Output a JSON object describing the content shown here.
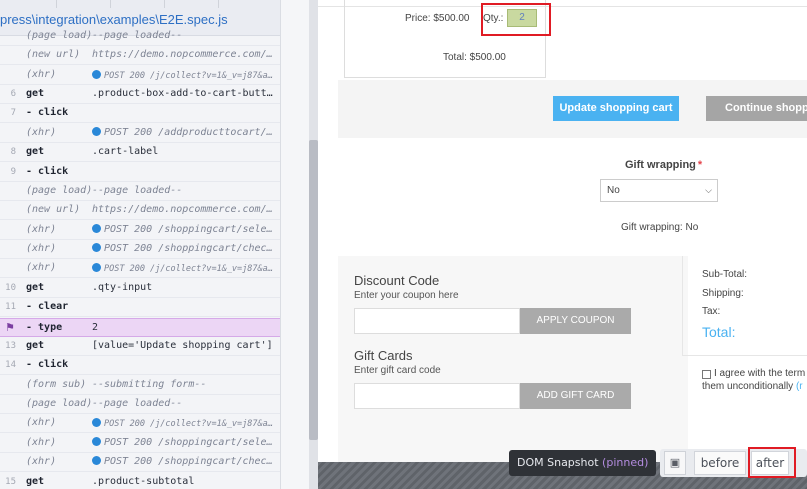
{
  "spec": {
    "path": "press\\integration\\examples\\E2E.spec.js"
  },
  "commands": [
    {
      "num": "",
      "name": "(page load)",
      "message": "--page loaded--",
      "style": "event",
      "xhr": false,
      "small": false,
      "pinned": false
    },
    {
      "num": "",
      "name": "(new url)",
      "message": "https://demo.nopcommerce.com/se…",
      "style": "event",
      "xhr": false,
      "small": false,
      "pinned": false
    },
    {
      "num": "",
      "name": "(xhr)",
      "message": "POST 200 /j/collect?v=1&_v=j87&a=1…",
      "style": "event",
      "xhr": true,
      "small": true,
      "pinned": false
    },
    {
      "num": "6",
      "name": "get",
      "message": ".product-box-add-to-cart-button",
      "style": "cmd",
      "xhr": false,
      "small": false,
      "pinned": false
    },
    {
      "num": "7",
      "name": "- click",
      "message": "",
      "style": "cmd",
      "xhr": false,
      "small": false,
      "pinned": false
    },
    {
      "num": "",
      "name": "(xhr)",
      "message": "POST 200 /addproducttocart/ca…",
      "style": "event",
      "xhr": true,
      "small": false,
      "pinned": false
    },
    {
      "num": "8",
      "name": "get",
      "message": ".cart-label",
      "style": "cmd",
      "xhr": false,
      "small": false,
      "pinned": false
    },
    {
      "num": "9",
      "name": "- click",
      "message": "",
      "style": "cmd",
      "xhr": false,
      "small": false,
      "pinned": false
    },
    {
      "num": "",
      "name": "(page load)",
      "message": "--page loaded--",
      "style": "event",
      "xhr": false,
      "small": false,
      "pinned": false
    },
    {
      "num": "",
      "name": "(new url)",
      "message": "https://demo.nopcommerce.com/ca…",
      "style": "event",
      "xhr": false,
      "small": false,
      "pinned": false
    },
    {
      "num": "",
      "name": "(xhr)",
      "message": "POST 200 /shoppingcart/select…",
      "style": "event",
      "xhr": true,
      "small": false,
      "pinned": false
    },
    {
      "num": "",
      "name": "(xhr)",
      "message": "POST 200 /shoppingcart/checko…",
      "style": "event",
      "xhr": true,
      "small": false,
      "pinned": false
    },
    {
      "num": "",
      "name": "(xhr)",
      "message": "POST 200 /j/collect?v=1&_v=j87&a=1…",
      "style": "event",
      "xhr": true,
      "small": true,
      "pinned": false
    },
    {
      "num": "10",
      "name": "get",
      "message": ".qty-input",
      "style": "cmd",
      "xhr": false,
      "small": false,
      "pinned": false
    },
    {
      "num": "11",
      "name": "- clear",
      "message": "",
      "style": "cmd",
      "xhr": false,
      "small": false,
      "pinned": false
    },
    {
      "num": "",
      "name": "- type",
      "message": "2",
      "style": "cmd",
      "xhr": false,
      "small": false,
      "pinned": true
    },
    {
      "num": "13",
      "name": "get",
      "message": "[value='Update shopping cart']",
      "style": "cmd",
      "xhr": false,
      "small": false,
      "pinned": false
    },
    {
      "num": "14",
      "name": "- click",
      "message": "",
      "style": "cmd",
      "xhr": false,
      "small": false,
      "pinned": false
    },
    {
      "num": "",
      "name": "(form sub)",
      "message": "--submitting form--",
      "style": "event",
      "xhr": false,
      "small": false,
      "pinned": false
    },
    {
      "num": "",
      "name": "(page load)",
      "message": "--page loaded--",
      "style": "event",
      "xhr": false,
      "small": false,
      "pinned": false
    },
    {
      "num": "",
      "name": "(xhr)",
      "message": "POST 200 /j/collect?v=1&_v=j87&a=3…",
      "style": "event",
      "xhr": true,
      "small": true,
      "pinned": false
    },
    {
      "num": "",
      "name": "(xhr)",
      "message": "POST 200 /shoppingcart/select…",
      "style": "event",
      "xhr": true,
      "small": false,
      "pinned": false
    },
    {
      "num": "",
      "name": "(xhr)",
      "message": "POST 200 /shoppingcart/checko…",
      "style": "event",
      "xhr": true,
      "small": false,
      "pinned": false
    },
    {
      "num": "15",
      "name": "get",
      "message": ".product-subtotal",
      "style": "cmd",
      "xhr": false,
      "small": false,
      "pinned": false
    }
  ],
  "cart": {
    "price": "Price: $500.00",
    "qty_label": "Qty.:",
    "qty_value": "2",
    "total": "Total: $500.00",
    "update_button": "Update shopping cart",
    "continue_button": "Continue shopping"
  },
  "gift_wrapping": {
    "label": "Gift wrapping",
    "required_mark": "*",
    "selected": "No",
    "summary": "Gift wrapping: No"
  },
  "discount": {
    "title": "Discount Code",
    "hint": "Enter your coupon here",
    "button": "APPLY COUPON"
  },
  "gift_cards": {
    "title": "Gift Cards",
    "hint": "Enter gift card code",
    "button": "ADD GIFT CARD"
  },
  "totals": {
    "subtotal": "Sub-Total:",
    "shipping": "Shipping:",
    "tax": "Tax:",
    "total": "Total:"
  },
  "terms": {
    "line1": "I agree with the term",
    "line2_prefix": "them unconditionally ",
    "line2_link": "(r"
  },
  "snapshot": {
    "label": "DOM Snapshot",
    "pinned": "(pinned)",
    "icon": "picture-icon",
    "before": "before",
    "after": "after"
  },
  "colors": {
    "accent": "#4ab2f1",
    "highlight": "#e01b24",
    "pinned_row": "#ecd6f5",
    "xhr_dot": "#2a88d8"
  }
}
